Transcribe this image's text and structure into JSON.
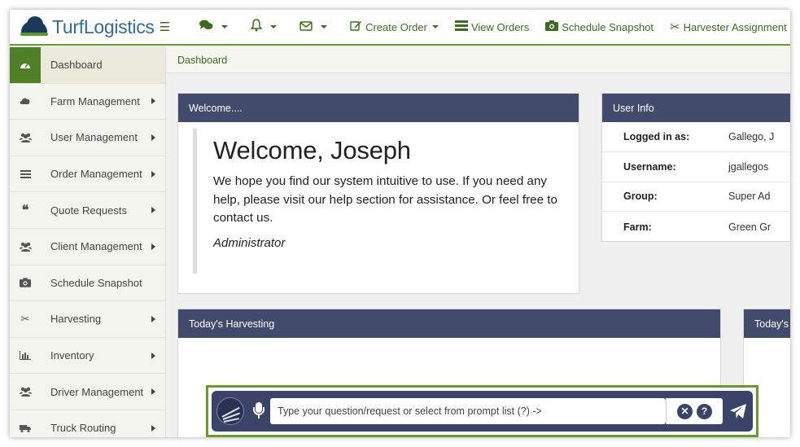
{
  "brand": {
    "part1": "Turf",
    "part2": "Logistics"
  },
  "nav": {
    "menu_icon": "hamburger-icon",
    "chat_icon": "comments-icon",
    "bell_icon": "bell-icon",
    "mail_icon": "envelope-icon",
    "create_order": "Create Order",
    "view_orders": "View Orders",
    "schedule_snapshot": "Schedule Snapshot",
    "harvester_assignment": "Harvester Assignment"
  },
  "sidebar": {
    "items": [
      {
        "label": "Dashboard",
        "icon": "dashboard-icon",
        "active": true,
        "submenu": false
      },
      {
        "label": "Farm Management",
        "icon": "cloud-icon",
        "submenu": true
      },
      {
        "label": "User Management",
        "icon": "users-icon",
        "submenu": true
      },
      {
        "label": "Order Management",
        "icon": "list-icon",
        "submenu": true
      },
      {
        "label": "Quote Requests",
        "icon": "quote-icon",
        "submenu": true
      },
      {
        "label": "Client Management",
        "icon": "users-icon",
        "submenu": true
      },
      {
        "label": "Schedule Snapshot",
        "icon": "camera-icon",
        "submenu": false
      },
      {
        "label": "Harvesting",
        "icon": "scissors-icon",
        "submenu": true
      },
      {
        "label": "Inventory",
        "icon": "bar-chart-icon",
        "submenu": true
      },
      {
        "label": "Driver Management",
        "icon": "users-icon",
        "submenu": true
      },
      {
        "label": "Truck Routing",
        "icon": "truck-icon",
        "submenu": true
      }
    ]
  },
  "breadcrumb": "Dashboard",
  "welcome": {
    "header": "Welcome....",
    "title": "Welcome, Joseph",
    "message": "We hope you find our system intuitive to use. If you need any help, please visit our help section for assistance. Or feel free to contact us.",
    "signature": "Administrator"
  },
  "user_info": {
    "header": "User Info",
    "rows": [
      {
        "key": "Logged in as:",
        "value": "Gallego, J"
      },
      {
        "key": "Username:",
        "value": "jgallegos"
      },
      {
        "key": "Group:",
        "value": "Super Ad"
      },
      {
        "key": "Farm:",
        "value": "Green Gr"
      }
    ]
  },
  "harvesting": {
    "header": "Today's Harvesting",
    "header2": "Today's"
  },
  "assistant": {
    "placeholder": "Type your question/request or select from prompt list (?) ->",
    "clear_label": "✕",
    "help_label": "?"
  },
  "colors": {
    "accent_green": "#6a9a2b",
    "panel_header": "#424b6b",
    "assistant_bg": "#3b4468"
  }
}
